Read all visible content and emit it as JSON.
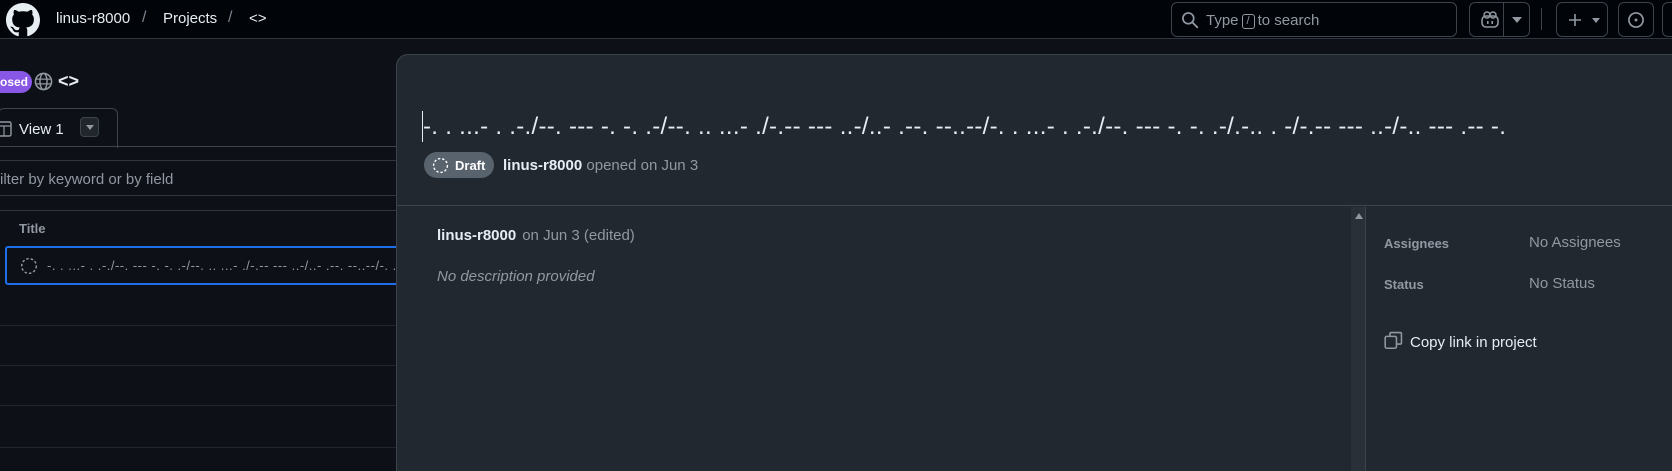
{
  "header": {
    "owner": "linus-r8000",
    "section": "Projects",
    "project": "<>",
    "search_prefix": "Type",
    "search_key": "/",
    "search_suffix": "to search"
  },
  "project": {
    "status": "Closed",
    "status_visible": "osed",
    "title": "<>",
    "view_tab": "View 1",
    "filter_placeholder": "Filter by keyword or by field",
    "filter_placeholder_visible": "ilter by keyword or by field",
    "column_title": "Title",
    "row_title": "-. . ...- . .-./--. --- -. -. .-/--. .. ...- ./-.-- --- ..-/..- .--. --..--/-. . ...- . .-./--. --- -. -. .-/.-.. . -/-.-- --- ..-/-.. --- .-- -."
  },
  "panel": {
    "title": "-. . ...- . .-./--. --- -. -. .-/--. .. ...- ./-.-- --- ..-/..- .--. --..--/-. . ...- . .-./--. --- -. -. .-/.-.. . -/-.-- --- ..-/-.. --- .-- -.",
    "badge": "Draft",
    "author": "linus-r8000",
    "opened": "opened on Jun 3",
    "comment_author": "linus-r8000",
    "comment_meta": "on Jun 3 (edited)",
    "comment_body": "No description provided",
    "assignees_label": "Assignees",
    "assignees_value": "No Assignees",
    "status_label": "Status",
    "status_value": "No Status",
    "copy_link": "Copy link in project"
  },
  "colors": {
    "closed": "#8957e5",
    "draft": "#59636e",
    "accent": "#1f6feb"
  }
}
